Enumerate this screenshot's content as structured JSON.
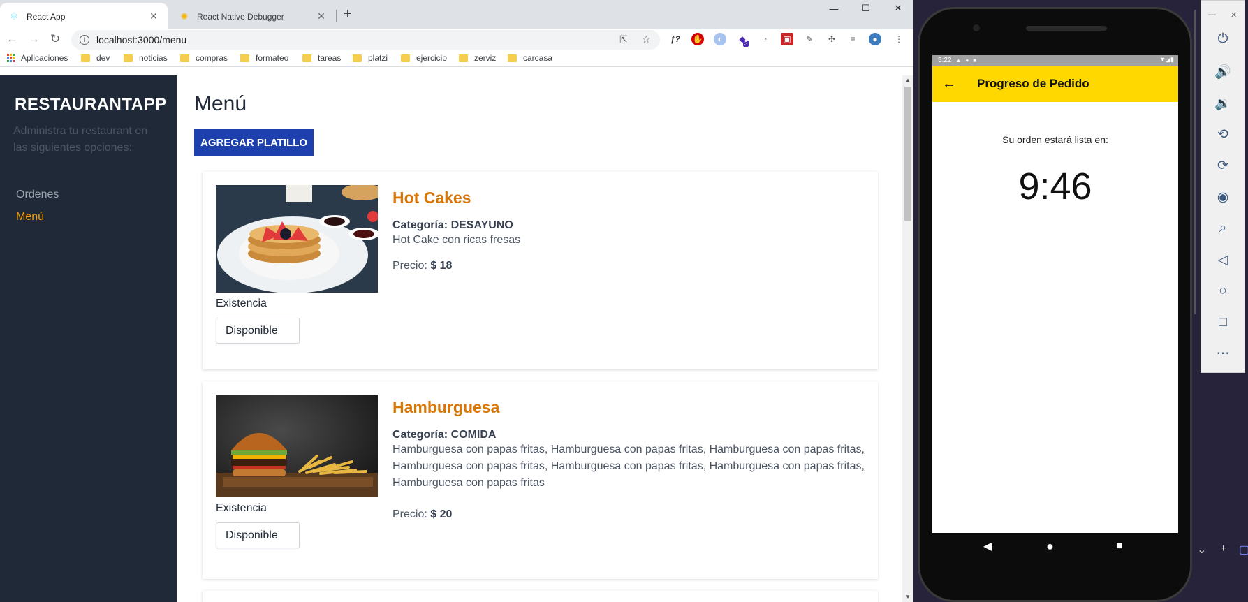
{
  "browser": {
    "tabs": [
      {
        "label": "React App",
        "active": true
      },
      {
        "label": "React Native Debugger",
        "active": false
      }
    ],
    "url": "localhost:3000/menu",
    "bookmarks": [
      "Aplicaciones",
      "dev",
      "noticias",
      "compras",
      "formateo",
      "tareas",
      "platzi",
      "ejercicio",
      "zerviz",
      "carcasa"
    ],
    "extension_badge": "3"
  },
  "sidebar": {
    "brand": "RESTAURANTAPP",
    "tagline": "Administra tu restaurant en las siguientes opciones:",
    "links": [
      {
        "label": "Ordenes",
        "active": false
      },
      {
        "label": "Menú",
        "active": true
      }
    ]
  },
  "main": {
    "title": "Menú",
    "add_button": "AGREGAR PLATILLO",
    "dishes": [
      {
        "name": "Hot Cakes",
        "category_label": "Categoría:",
        "category": "DESAYUNO",
        "description": "Hot Cake con ricas fresas",
        "price_label": "Precio:",
        "price": "$ 18",
        "stock_label": "Existencia",
        "stock_value": "Disponible",
        "image": "pancakes-photo"
      },
      {
        "name": "Hamburguesa",
        "category_label": "Categoría:",
        "category": "COMIDA",
        "description": "Hamburguesa con papas fritas, Hamburguesa con papas fritas, Hamburguesa con papas fritas, Hamburguesa con papas fritas, Hamburguesa con papas fritas, Hamburguesa con papas fritas, Hamburguesa con papas fritas",
        "price_label": "Precio:",
        "price": "$ 20",
        "stock_label": "Existencia",
        "stock_value": "Disponible",
        "image": "burger-photo"
      }
    ]
  },
  "phone": {
    "time": "5:22",
    "appbar_title": "Progreso de Pedido",
    "order_text": "Su orden estará lista en:",
    "timer": "9:46",
    "accent": "#ffd800"
  },
  "colors": {
    "sidebar_bg": "#1f2937",
    "accent_orange": "#d97706",
    "button_blue": "#1e40af"
  }
}
